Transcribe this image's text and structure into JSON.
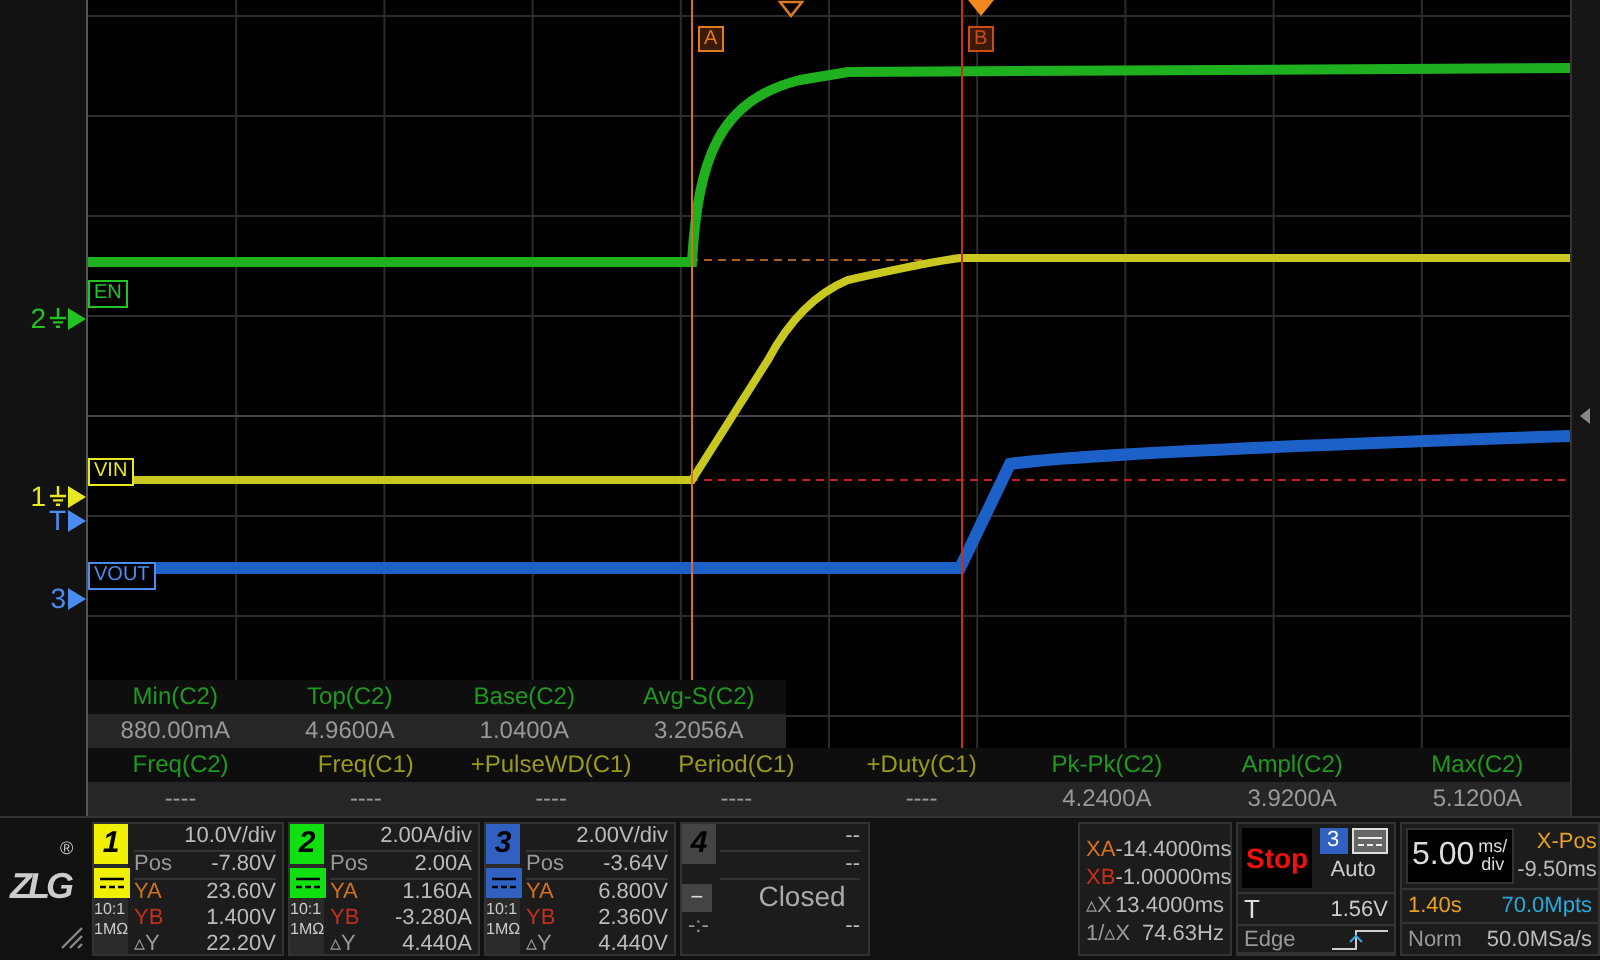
{
  "plot": {
    "cursor_tags": [
      {
        "text": "A",
        "color": "#e07a20"
      },
      {
        "text": "B",
        "color": "#d04a18"
      }
    ],
    "channel_markers": [
      {
        "label": "2",
        "color": "#22c422",
        "ground": true
      },
      {
        "label": "1",
        "color": "#e8e820",
        "ground": true
      },
      {
        "label": "T",
        "color": "#4a8cf0",
        "ground": false
      },
      {
        "label": "3",
        "color": "#4a8cf0",
        "ground": false
      }
    ],
    "trace_labels": [
      {
        "text": "EN",
        "color": "#22c422"
      },
      {
        "text": "VIN",
        "color": "#e8e820"
      },
      {
        "text": "VOUT",
        "color": "#4a8cf0"
      }
    ]
  },
  "measurements": {
    "top_rows": [
      {
        "name": "Min(C2)",
        "value": "880.00mA",
        "color": "#1f9a1f"
      },
      {
        "name": "Top(C2)",
        "value": "4.9600A",
        "color": "#1f9a1f"
      },
      {
        "name": "Base(C2)",
        "value": "1.0400A",
        "color": "#1f9a1f"
      },
      {
        "name": "Avg-S(C2)",
        "value": "3.2056A",
        "color": "#1f9a1f"
      }
    ],
    "bottom_rows": [
      {
        "name": "Freq(C2)",
        "value": "----",
        "color": "#1f9a1f"
      },
      {
        "name": "Freq(C1)",
        "value": "----",
        "color": "#9a9a1a"
      },
      {
        "name": "+PulseWD(C1)",
        "value": "----",
        "color": "#9a9a1a"
      },
      {
        "name": "Period(C1)",
        "value": "----",
        "color": "#9a9a1a"
      },
      {
        "name": "+Duty(C1)",
        "value": "----",
        "color": "#9a9a1a"
      },
      {
        "name": "Pk-Pk(C2)",
        "value": "4.2400A",
        "color": "#1f9a1f"
      },
      {
        "name": "Ampl(C2)",
        "value": "3.9200A",
        "color": "#1f9a1f"
      },
      {
        "name": "Max(C2)",
        "value": "5.1200A",
        "color": "#1f9a1f"
      }
    ]
  },
  "logo": {
    "text": "ZLG",
    "mark": "®"
  },
  "channels": [
    {
      "number": "1",
      "color": "#f0f000",
      "scale": "10.0V/div",
      "pos_label": "Pos",
      "pos": "-7.80V",
      "ya_label": "YA",
      "ya": "23.60V",
      "yb_label": "YB",
      "yb": "1.400V",
      "dy_label": "▵Y",
      "dy": "22.20V",
      "probe": "10:1",
      "impedance": "1MΩ"
    },
    {
      "number": "2",
      "color": "#10e010",
      "scale": "2.00A/div",
      "pos_label": "Pos",
      "pos": "2.00A",
      "ya_label": "YA",
      "ya": "1.160A",
      "yb_label": "YB",
      "yb": "-3.280A",
      "dy_label": "▵Y",
      "dy": "4.440A",
      "probe": "10:1",
      "impedance": "1MΩ"
    },
    {
      "number": "3",
      "color": "#3060c0",
      "scale": "2.00V/div",
      "pos_label": "Pos",
      "pos": "-3.64V",
      "ya_label": "YA",
      "ya": "6.800V",
      "yb_label": "YB",
      "yb": "2.360V",
      "dy_label": "▵Y",
      "dy": "4.440V",
      "probe": "10:1",
      "impedance": "1MΩ"
    }
  ],
  "channel4": {
    "number": "4",
    "line_1": "--",
    "line_2": "--",
    "minus": "−",
    "status": "Closed",
    "misc": "-:-",
    "line_3": "--"
  },
  "cursors": [
    {
      "label": "XA",
      "value": "-14.4000ms",
      "kind": "a"
    },
    {
      "label": "XB",
      "value": "-1.00000ms",
      "kind": "b"
    },
    {
      "label": "▵X",
      "value": "13.4000ms",
      "kind": "plain"
    },
    {
      "label": "1/▵X",
      "value": "74.63Hz",
      "kind": "plain"
    }
  ],
  "trigger": {
    "run_state": "Stop",
    "source": {
      "text": "3",
      "color": "#3060c0"
    },
    "mode": "Auto",
    "level_label": "T",
    "level": "1.56V",
    "type": "Edge"
  },
  "timebase": {
    "scale": "5.00",
    "unit_top": "ms/",
    "unit_bottom": "div",
    "xpos_label": "X-Pos",
    "xpos": "-9.50ms",
    "duration": "1.40s",
    "points": "70.0Mpts",
    "acq_mode": "Norm",
    "sample_rate": "50.0MSa/s"
  }
}
